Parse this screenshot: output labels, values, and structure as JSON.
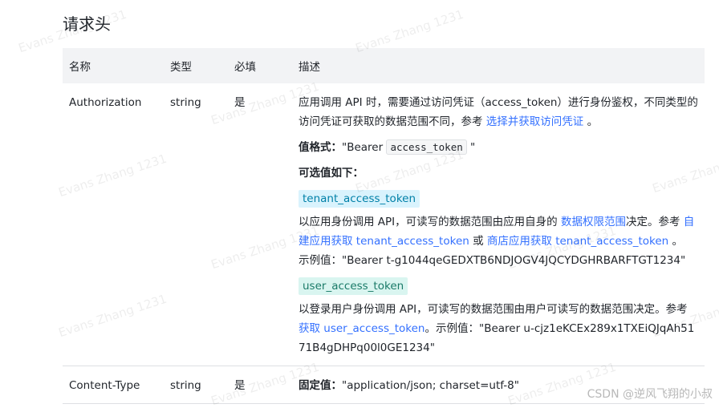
{
  "section_title": "请求头",
  "headers": [
    "名称",
    "类型",
    "必填",
    "描述"
  ],
  "rows": [
    {
      "name": "Authorization",
      "type": "string",
      "required": "是",
      "desc1_a": "应用调用 API 时，需要通过访问凭证（access_token）进行身份鉴权，不同类型的访问凭证可获取的数据范围不同，参考 ",
      "desc1_link": "选择并获取访问凭证",
      "desc1_end": " 。",
      "format_label": "值格式：",
      "format_pre": "\"Bearer ",
      "format_code": "access_token",
      "format_post": " \"",
      "options_label": "可选值如下：",
      "tenant_tag": "tenant_access_token",
      "tenant_a": "以应用身份调用 API，可读写的数据范围由应用自身的 ",
      "tenant_link1": "数据权限范围",
      "tenant_b": "决定。参考 ",
      "tenant_link2": "自建应用获取 tenant_access_token",
      "tenant_c": " 或 ",
      "tenant_link3": "商店应用获取 tenant_access_token",
      "tenant_d": " 。",
      "tenant_example": "示例值：\"Bearer t-g1044qeGEDXTB6NDJOGV4JQCYDGHRBARFTGT1234\"",
      "user_tag": "user_access_token",
      "user_a": "以登录用户身份调用 API，可读写的数据范围由用户可读写的数据范围决定。参考 ",
      "user_link": "获取 user_access_token",
      "user_b": "。示例值：\"Bearer u-cjz1eKCEx289x1TXEiQJqAh5171B4gDHPq00l0GE1234\""
    },
    {
      "name": "Content-Type",
      "type": "string",
      "required": "是",
      "fixed_label": "固定值：",
      "fixed_value": "\"application/json; charset=utf-8\""
    }
  ],
  "watermark": "Evans Zhang 1231",
  "csdn_watermark": "CSDN @逆风飞翔的小叔"
}
